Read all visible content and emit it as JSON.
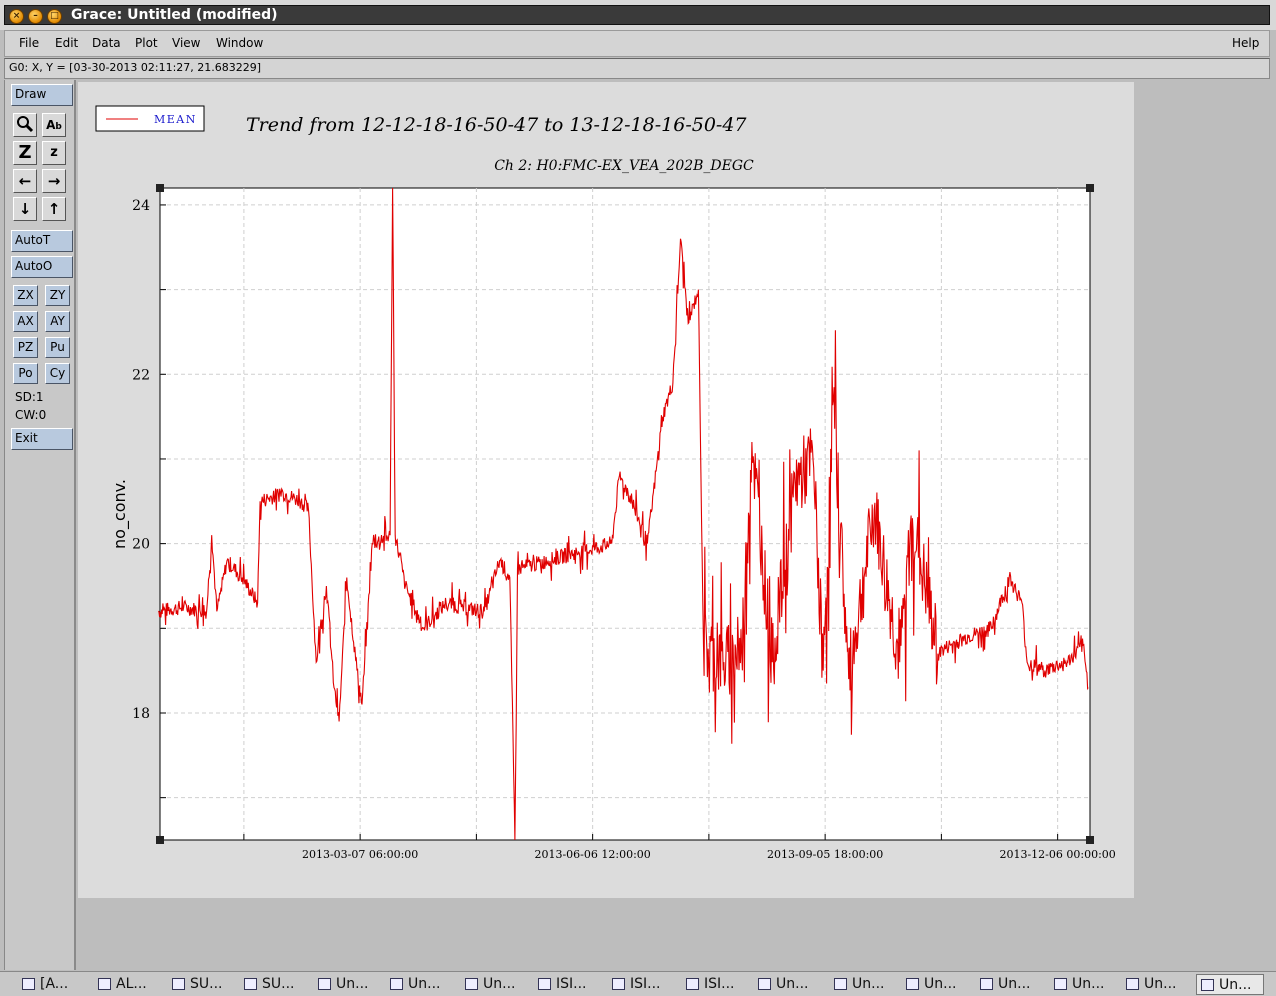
{
  "window": {
    "title": "Grace: Untitled (modified)"
  },
  "menu": {
    "file": "File",
    "edit": "Edit",
    "data": "Data",
    "plot": "Plot",
    "view": "View",
    "window": "Window",
    "help": "Help"
  },
  "locator": "G0: X, Y = [03-30-2013 02:11:27, 21.683229]",
  "toolbar": {
    "draw": "Draw",
    "autot": "AutoT",
    "autoo": "AutoO",
    "zx": "ZX",
    "zy": "ZY",
    "ax": "AX",
    "ay": "AY",
    "pz": "PZ",
    "pu": "Pu",
    "po": "Po",
    "cy": "Cy",
    "sd": "SD:1",
    "cw": "CW:0",
    "exit": "Exit"
  },
  "chart_data": {
    "type": "line",
    "title": "Trend from 12-12-18-16-50-47 to 13-12-18-16-50-47",
    "subtitle": "Ch 2: H0:FMC-EX_VEA_202B_DEGC",
    "xlabel": "",
    "ylabel": "no_conv.",
    "legend": {
      "placement": "top-left",
      "entries": [
        "MEAN"
      ]
    },
    "x_tick_labels": [
      "2013-03-07 06:00:00",
      "2013-06-06 12:00:00",
      "2013-09-05 18:00:00",
      "2013-12-06 00:00:00"
    ],
    "y_tick_labels": [
      "18",
      "20",
      "22",
      "24"
    ],
    "xlim": [
      "2012-12-18 16:50:47",
      "2013-12-18 16:50:47"
    ],
    "ylim": [
      16.5,
      24.2
    ],
    "grid": true,
    "series_color": "#e00000",
    "series": [
      {
        "name": "MEAN",
        "points": [
          [
            "2012-12-18",
            19.2
          ],
          [
            "2012-12-28",
            19.25
          ],
          [
            "2013-01-06",
            19.2
          ],
          [
            "2013-01-08",
            20.1
          ],
          [
            "2013-01-10",
            19.2
          ],
          [
            "2013-01-14",
            19.8
          ],
          [
            "2013-01-20",
            19.6
          ],
          [
            "2013-01-26",
            19.3
          ],
          [
            "2013-01-27",
            20.5
          ],
          [
            "2013-02-05",
            20.6
          ],
          [
            "2013-02-12",
            20.5
          ],
          [
            "2013-02-15",
            20.4
          ],
          [
            "2013-02-18",
            18.6
          ],
          [
            "2013-02-22",
            19.5
          ],
          [
            "2013-02-25",
            18.3
          ],
          [
            "2013-02-27",
            17.9
          ],
          [
            "2013-03-02",
            19.6
          ],
          [
            "2013-03-06",
            18.5
          ],
          [
            "2013-03-08",
            18.1
          ],
          [
            "2013-03-12",
            20.0
          ],
          [
            "2013-03-19",
            20.1
          ],
          [
            "2013-03-20",
            24.2
          ],
          [
            "2013-03-21",
            20.1
          ],
          [
            "2013-03-25",
            19.5
          ],
          [
            "2013-04-01",
            19.0
          ],
          [
            "2013-04-10",
            19.3
          ],
          [
            "2013-04-16",
            19.25
          ],
          [
            "2013-04-25",
            19.2
          ],
          [
            "2013-05-01",
            19.8
          ],
          [
            "2013-05-05",
            19.6
          ],
          [
            "2013-05-07",
            16.5
          ],
          [
            "2013-05-08",
            19.7
          ],
          [
            "2013-05-20",
            19.8
          ],
          [
            "2013-06-01",
            19.9
          ],
          [
            "2013-06-14",
            20.0
          ],
          [
            "2013-06-17",
            20.8
          ],
          [
            "2013-06-22",
            20.5
          ],
          [
            "2013-06-28",
            20.0
          ],
          [
            "2013-07-04",
            21.5
          ],
          [
            "2013-07-08",
            21.9
          ],
          [
            "2013-07-11",
            23.6
          ],
          [
            "2013-07-14",
            22.6
          ],
          [
            "2013-07-18",
            23.0
          ],
          [
            "2013-07-20",
            18.8
          ],
          [
            "2013-07-28",
            18.6
          ],
          [
            "2013-08-04",
            18.7
          ],
          [
            "2013-08-08",
            21.2
          ],
          [
            "2013-08-16",
            18.6
          ],
          [
            "2013-08-25",
            20.7
          ],
          [
            "2013-09-01",
            21.0
          ],
          [
            "2013-09-05",
            18.5
          ],
          [
            "2013-09-09",
            21.7
          ],
          [
            "2013-09-15",
            18.4
          ],
          [
            "2013-09-25",
            20.4
          ],
          [
            "2013-10-05",
            18.6
          ],
          [
            "2013-10-10",
            20.3
          ],
          [
            "2013-10-20",
            18.7
          ],
          [
            "2013-10-25",
            18.8
          ],
          [
            "2013-11-01",
            18.9
          ],
          [
            "2013-11-10",
            19.0
          ],
          [
            "2013-11-17",
            19.6
          ],
          [
            "2013-11-22",
            19.3
          ],
          [
            "2013-11-24",
            18.6
          ],
          [
            "2013-12-01",
            18.5
          ],
          [
            "2013-12-10",
            18.6
          ],
          [
            "2013-12-16",
            18.8
          ],
          [
            "2013-12-18",
            18.3
          ]
        ]
      }
    ]
  },
  "taskbar": {
    "items": [
      "[A...",
      "AL...",
      "SU...",
      "SU...",
      "Un...",
      "Un...",
      "Un...",
      "ISI...",
      "ISI...",
      "ISI...",
      "Un...",
      "Un...",
      "Un...",
      "Un...",
      "Un...",
      "Un...",
      "Un..."
    ]
  }
}
